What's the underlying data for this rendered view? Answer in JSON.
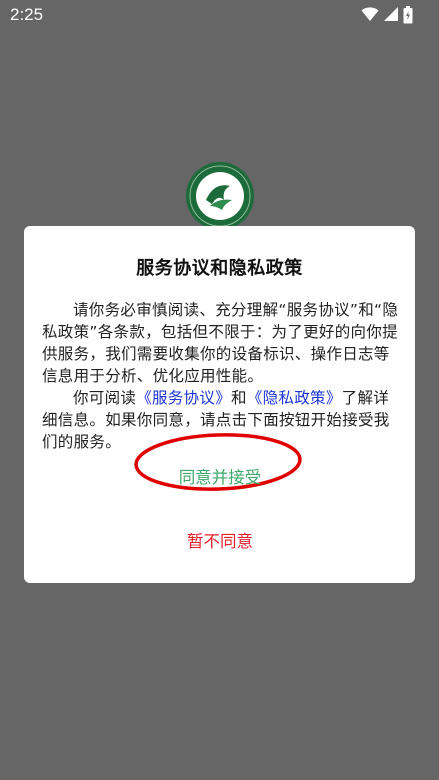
{
  "status_bar": {
    "time": "2:25",
    "icons": [
      "wifi-icon",
      "cellular-signal-icon",
      "battery-icon"
    ]
  },
  "logo": {
    "icon": "app-logo-emblem",
    "colors": {
      "ring": "#1d6b3a",
      "inner": "#ffffff"
    }
  },
  "dialog": {
    "title": "服务协议和隐私政策",
    "paragraph1": "请你务必审慎阅读、充分理解“服务协议”和“隐私政策”各条款，包括但不限于：为了更好的向你提供服务，我们需要收集你的设备标识、操作日志等信息用于分析、优化应用性能。",
    "paragraph2_prefix": "你可阅读",
    "service_agreement_link": "《服务协议》",
    "and_text": "和",
    "privacy_policy_link": "《隐私政策》",
    "paragraph2_suffix": "了解详细信息。如果你同意，请点击下面按钮开始接受我们的服务。",
    "accept_button": "同意并接受",
    "decline_button": "暂不同意"
  },
  "colors": {
    "overlay": "#666666",
    "link": "#1d35d6",
    "accept": "#3fa86a",
    "decline": "#e2202a",
    "annotation": "#e00000"
  }
}
